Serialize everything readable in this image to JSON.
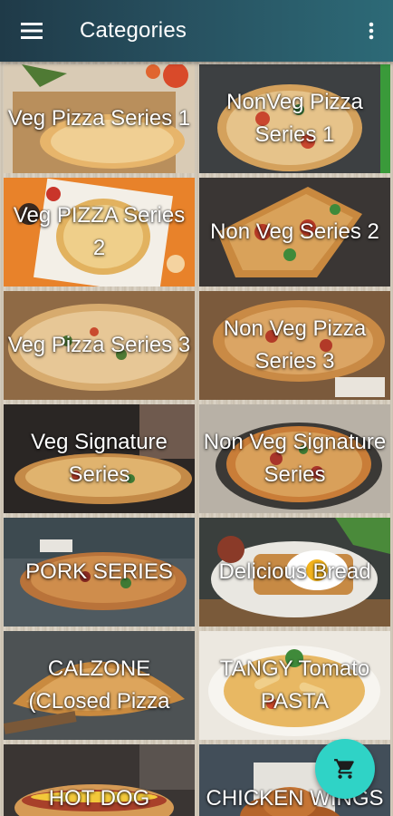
{
  "appbar": {
    "title": "Categories",
    "menu_icon": "hamburger-menu-icon",
    "overflow_icon": "more-vert-icon"
  },
  "categories": [
    {
      "label": "Veg Pizza Series 1"
    },
    {
      "label": "NonVeg Pizza Series 1"
    },
    {
      "label": "Veg PIZZA Series 2"
    },
    {
      "label": "Non Veg Series 2"
    },
    {
      "label": "Veg Pizza Series 3"
    },
    {
      "label": "Non Veg Pizza Series 3"
    },
    {
      "label": "Veg Signature Series"
    },
    {
      "label": "Non Veg Signature Series"
    },
    {
      "label": "PORK SERIES"
    },
    {
      "label": "Delicious Bread"
    },
    {
      "label": "CALZONE (CLosed Pizza"
    },
    {
      "label": "TANGY Tomato PASTA"
    },
    {
      "label": "HOT DOG"
    },
    {
      "label": "CHICKEN WINGS"
    }
  ],
  "fab": {
    "icon": "shopping-cart-icon"
  },
  "colors": {
    "appbar_start": "#1f3a48",
    "appbar_end": "#2d6a77",
    "fab": "#2fd3c6",
    "label_text": "#ffffff"
  }
}
